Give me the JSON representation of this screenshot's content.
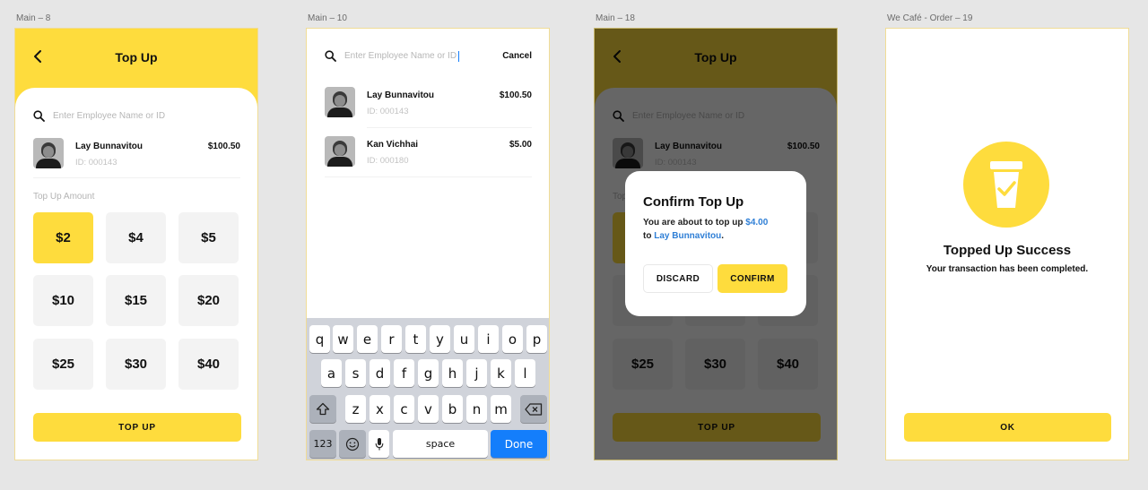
{
  "artboards": [
    {
      "label": "Main – 8"
    },
    {
      "label": "Main – 10"
    },
    {
      "label": "Main – 18"
    },
    {
      "label": "We Café - Order – 19"
    }
  ],
  "topup": {
    "title": "Top Up",
    "search_placeholder": "Enter Employee Name or ID",
    "employee": {
      "name": "Lay Bunnavitou",
      "id": "ID: 000143",
      "balance": "$100.50"
    },
    "amount_label": "Top Up Amount",
    "amounts": [
      "$2",
      "$4",
      "$5",
      "$10",
      "$15",
      "$20",
      "$25",
      "$30",
      "$40"
    ],
    "selected_index": 0,
    "button": "TOP UP"
  },
  "search": {
    "placeholder": "Enter Employee Name or ID",
    "cancel": "Cancel",
    "results": [
      {
        "name": "Lay Bunnavitou",
        "id": "ID: 000143",
        "balance": "$100.50"
      },
      {
        "name": "Kan Vichhai",
        "id": "ID: 000180",
        "balance": "$5.00"
      }
    ],
    "keyboard": {
      "row1": [
        "q",
        "w",
        "e",
        "r",
        "t",
        "y",
        "u",
        "i",
        "o",
        "p"
      ],
      "row2": [
        "a",
        "s",
        "d",
        "f",
        "g",
        "h",
        "j",
        "k",
        "l"
      ],
      "row3": [
        "z",
        "x",
        "c",
        "v",
        "b",
        "n",
        "m"
      ],
      "num": "123",
      "space": "space",
      "done": "Done"
    }
  },
  "confirm": {
    "title": "Confirm Top Up",
    "body_prefix": "You are about to top up",
    "amount": "$4.00",
    "body_to": "to",
    "name": "Lay Bunnavitou",
    "period": ".",
    "discard": "DISCARD",
    "confirm": "CONFIRM"
  },
  "success": {
    "title": "Topped Up Success",
    "subtitle": "Your transaction has been completed.",
    "ok": "OK"
  },
  "colors": {
    "accent": "#fedc3d",
    "link": "#2f7fd6",
    "ios_blue": "#147efb"
  }
}
